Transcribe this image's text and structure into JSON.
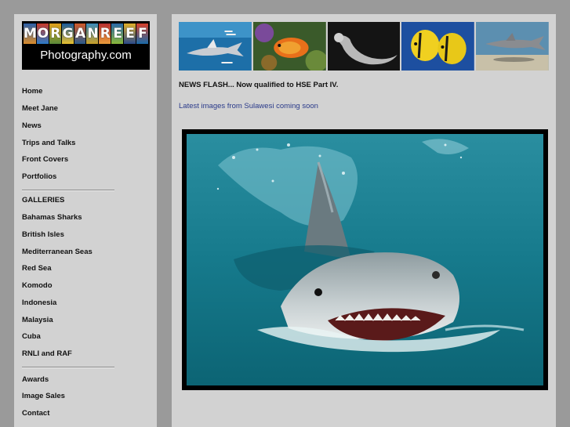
{
  "site": {
    "logo_letters": [
      "M",
      "O",
      "R",
      "G",
      "A",
      "N",
      "R",
      "E",
      "E",
      "F"
    ],
    "logo_subtitle": "Photography.com"
  },
  "nav": {
    "primary": [
      "Home",
      "Meet Jane",
      "News",
      "Trips and Talks",
      "Front Covers",
      "Portfolios"
    ],
    "galleries_heading": "GALLERIES",
    "galleries": [
      "Bahamas Sharks",
      "British Isles",
      "Mediterranean Seas",
      "Red Sea",
      "Komodo",
      "Indonesia",
      "Malaysia",
      "Cuba",
      "RNLI and RAF"
    ],
    "footer": [
      "Awards",
      "Image Sales",
      "Contact"
    ]
  },
  "banner": {
    "panels": [
      "oceanic-whitetip-shark",
      "anthias-coral-reef",
      "seal-silhouette",
      "butterflyfish-pair",
      "tiger-shark"
    ]
  },
  "main": {
    "news_flash": "NEWS FLASH... Now qualified to HSE Part IV.",
    "news_link": "Latest images from Sulawesi coming soon",
    "feature_photo": "tiger-shark-surfacing"
  },
  "colors": {
    "page_bg": "#9a9a9a",
    "panel_bg": "#d2d2d2",
    "link": "#2a3a8a",
    "water": "#167a8c"
  }
}
